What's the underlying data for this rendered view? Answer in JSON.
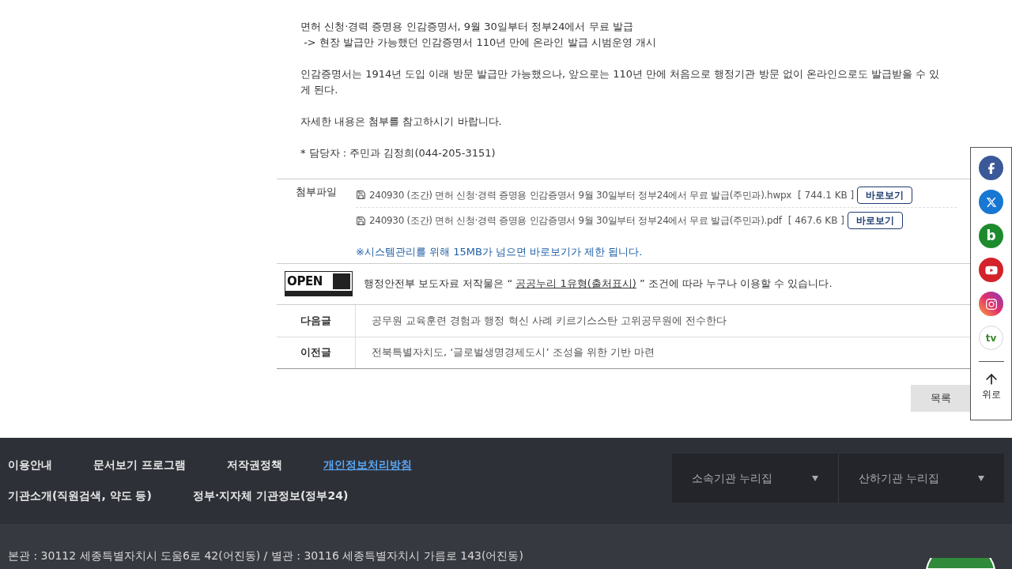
{
  "article": {
    "paragraphs": [
      "면허 신청·경력 증명용 인감증명서, 9월 30일부터 정부24에서 무료 발급\n -> 현장 발급만 가능했던 인감증명서 110년 만에 온라인 발급 시범운영 개시",
      "인감증명서는 1914년 도입 이래 방문 발급만 가능했으나, 앞으로는 110년 만에 처음으로 행정기관 방문 없이 온라인으로도 발급받을 수 있게 된다.",
      "자세한 내용은 첨부를 참고하시기 바랍니다.",
      "* 담당자 : 주민과 김정희(044-205-3151)"
    ]
  },
  "attachments": {
    "label": "첨부파일",
    "files": [
      {
        "name": "240930 (조간) 면허 신청·경력 증명용 인감증명서 9월 30일부터 정부24에서 무료 발급(주민과).hwpx",
        "size": "[ 744.1 KB ]",
        "button": "바로보기"
      },
      {
        "name": "240930 (조간) 면허 신청·경력 증명용 인감증명서 9월 30일부터 정부24에서 무료 발급(주민과).pdf",
        "size": "[ 467.6 KB ]",
        "button": "바로보기"
      }
    ],
    "notice": "※시스템관리를 위해 15MB가 넘으면 바로보기가 제한 됩니다."
  },
  "license": {
    "logo_text": "OPEN",
    "before": "행정안전부 보도자료 저작물은 “ ",
    "link": "공공누리 1유형(출처표시)",
    "after": " ” 조건에 따라 누구나 이용할 수 있습니다."
  },
  "navigation": [
    {
      "label": "다음글",
      "title": "공무원 교육훈련 경험과 행정 혁신 사례 키르기스스탄 고위공무원에 전수한다"
    },
    {
      "label": "이전글",
      "title": "전북특별자치도, ‘글로벌생명경제도시’ 조성을 위한 기반 마련"
    }
  ],
  "list_button": "목록",
  "side_bar": {
    "social": [
      {
        "kind": "facebook"
      },
      {
        "kind": "x"
      },
      {
        "kind": "blog",
        "glyph": "b"
      },
      {
        "kind": "youtube"
      },
      {
        "kind": "instagram"
      },
      {
        "kind": "tv",
        "glyph": "tv"
      }
    ],
    "top_label": "위로"
  },
  "footer": {
    "link_rows": [
      [
        {
          "label": "이용안내",
          "highlighted": false
        },
        {
          "label": "문서보기 프로그램",
          "highlighted": false
        },
        {
          "label": "저작권정책",
          "highlighted": false
        },
        {
          "label": "개인정보처리방침",
          "highlighted": true
        }
      ],
      [
        {
          "label": "기관소개(직원검색, 약도 등)",
          "highlighted": false
        },
        {
          "label": "정부·지자체 기관정보(정부24)",
          "highlighted": false
        }
      ]
    ],
    "selects": [
      "소속기관 누리집",
      "산하기관 누리집"
    ],
    "address": "본관 : 30112 세종특별자치시 도움6로 42(어진동) / 별관 : 30116 세종특별자치시 가름로 143(어진동)"
  }
}
